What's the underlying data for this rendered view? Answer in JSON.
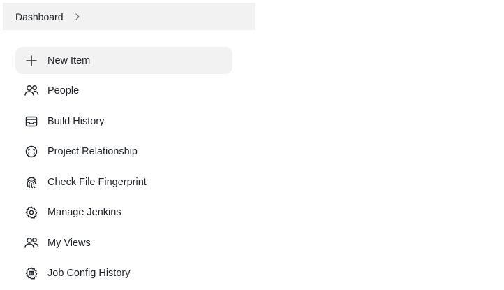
{
  "breadcrumb": {
    "items": [
      {
        "label": "Dashboard"
      }
    ],
    "separator_icon": "chevron-right-icon"
  },
  "tasks": [
    {
      "label": "New Item",
      "icon": "plus-icon",
      "active": true
    },
    {
      "label": "People",
      "icon": "people-icon"
    },
    {
      "label": "Build History",
      "icon": "inbox-icon"
    },
    {
      "label": "Project Relationship",
      "icon": "relationship-icon"
    },
    {
      "label": "Check File Fingerprint",
      "icon": "fingerprint-icon"
    },
    {
      "label": "Manage Jenkins",
      "icon": "gear-icon"
    },
    {
      "label": "My Views",
      "icon": "people-icon"
    },
    {
      "label": "Job Config History",
      "icon": "config-history-icon"
    }
  ],
  "colors": {
    "text": "#1f2328",
    "breadcrumb_bg": "#f2f2f2",
    "active_item_bg": "#f2f2f2"
  }
}
